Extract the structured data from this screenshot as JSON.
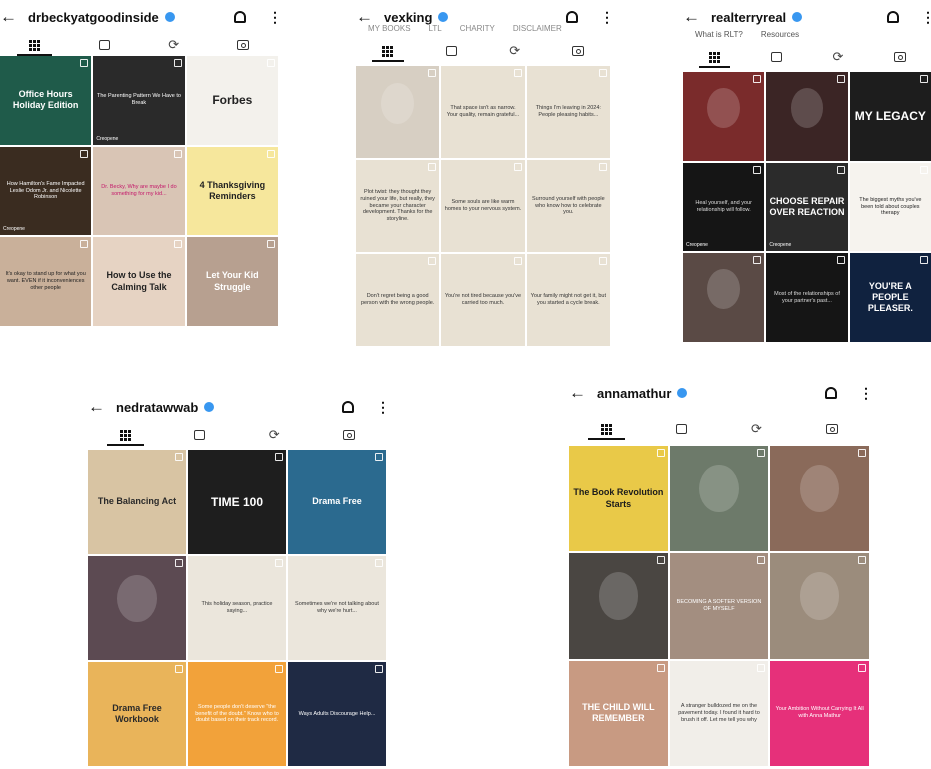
{
  "colors": {
    "verified": "#3897f0",
    "text": "#111111"
  },
  "icons": {
    "back": "back-arrow-icon",
    "notifications": "bell-icon",
    "more": "more-dots-icon",
    "posts": "grid-icon",
    "reels": "reels-icon",
    "tagged": "tagged-icon"
  },
  "glyphs": {
    "back": "←",
    "more": "⋮",
    "reels": "⟳"
  },
  "panels": [
    {
      "username": "drbeckyatgoodinside",
      "cells": [
        {
          "text": "Office Hours Holiday Edition",
          "bg": "#1f5b4a",
          "fg": "#ffffff"
        },
        {
          "text": "The Parenting Pattern We Have to Break",
          "bg": "#2a2a2a",
          "fg": "#ffffff",
          "label": "Creopene"
        },
        {
          "text": "Forbes",
          "bg": "#f3f1ec",
          "fg": "#222222"
        },
        {
          "text": "How Hamilton's Fame Impacted Leslie Odom Jr. and Nicolette Robinson",
          "bg": "#3a2c20",
          "fg": "#ffffff",
          "label": "Creopene"
        },
        {
          "text": "Dr. Becky, Why are maybe I do something for my kid...",
          "bg": "#d9c5b5",
          "fg": "#c4186a"
        },
        {
          "text": "4 Thanksgiving Reminders",
          "bg": "#f6e79c",
          "fg": "#222222"
        },
        {
          "text": "It's okay to stand up for what you want. EVEN if it inconveniences other people",
          "bg": "#c9b09a",
          "fg": "#222222"
        },
        {
          "text": "How to Use the Calming Talk",
          "bg": "#e6d3c3",
          "fg": "#222222"
        },
        {
          "text": "Let Your Kid Struggle",
          "bg": "#b7a090",
          "fg": "#ffffff"
        }
      ]
    },
    {
      "username": "vexking",
      "subnav": [
        "MY BOOKS",
        "LTL",
        "CHARITY",
        "DISCLAIMER"
      ],
      "cells": [
        {
          "text": "",
          "bg": "#d7cfc3",
          "fg": "#222222"
        },
        {
          "text": "That space isn't as narrow. Your quality, remain grateful...",
          "bg": "#e8e1d3",
          "fg": "#333333"
        },
        {
          "text": "Things I'm leaving in 2024: People pleasing habits...",
          "bg": "#e8e1d3",
          "fg": "#333333"
        },
        {
          "text": "Plot twist: they thought they ruined your life, but really, they became your character development. Thanks for the storyline.",
          "bg": "#e8e1d3",
          "fg": "#333333"
        },
        {
          "text": "Some souls are like warm homes to your nervous system.",
          "bg": "#e8e1d3",
          "fg": "#333333"
        },
        {
          "text": "Surround yourself with people who know how to celebrate you.",
          "bg": "#e8e1d3",
          "fg": "#333333"
        },
        {
          "text": "Don't regret being a good person with the wrong people.",
          "bg": "#e8e1d3",
          "fg": "#333333"
        },
        {
          "text": "You're not tired because you've carried too much.",
          "bg": "#e8e1d3",
          "fg": "#333333"
        },
        {
          "text": "Your family might not get it, but you started a cycle break.",
          "bg": "#e8e1d3",
          "fg": "#333333"
        }
      ]
    },
    {
      "username": "realterryreal",
      "subnav": [
        "What is RLT?",
        "Resources"
      ],
      "cells": [
        {
          "text": "",
          "bg": "#7a2b2b",
          "fg": "#ffffff"
        },
        {
          "text": "",
          "bg": "#3b2525",
          "fg": "#ffffff"
        },
        {
          "text": "MY LEGACY",
          "bg": "#1d1d1d",
          "fg": "#ffffff"
        },
        {
          "text": "Heal yourself, and your relationship will follow.",
          "bg": "#151515",
          "fg": "#dddddd",
          "label": "Creopene"
        },
        {
          "text": "CHOOSE REPAIR OVER REACTION",
          "bg": "#2b2b2b",
          "fg": "#ffffff",
          "label": "Creopene"
        },
        {
          "text": "The biggest myths you've been told about couples therapy",
          "bg": "#f6f3ee",
          "fg": "#1c1c1c"
        },
        {
          "text": "",
          "bg": "#5a4a45",
          "fg": "#ffffff"
        },
        {
          "text": "Most of the relationships of your partner's past...",
          "bg": "#151515",
          "fg": "#dddddd"
        },
        {
          "text": "YOU'RE A PEOPLE PLEASER.",
          "bg": "#10223f",
          "fg": "#ffffff"
        }
      ]
    },
    {
      "username": "nedratawwab",
      "cells": [
        {
          "text": "The Balancing Act",
          "bg": "#d8c4a3",
          "fg": "#2a2a2a"
        },
        {
          "text": "TIME 100",
          "bg": "#1e1e1e",
          "fg": "#ffffff"
        },
        {
          "text": "Drama Free",
          "bg": "#2b6a8f",
          "fg": "#ffffff"
        },
        {
          "text": "",
          "bg": "#5c4a52",
          "fg": "#ffffff"
        },
        {
          "text": "This holiday season, practice saying...",
          "bg": "#ebe6dc",
          "fg": "#333333"
        },
        {
          "text": "Sometimes we're not talking about why we're hurt...",
          "bg": "#ebe6dc",
          "fg": "#333333"
        },
        {
          "text": "Drama Free Workbook",
          "bg": "#e9b45a",
          "fg": "#2a2a2a"
        },
        {
          "text": "Some people don't deserve \"the benefit of the doubt.\" Know who to doubt based on their track record.",
          "bg": "#f2a23a",
          "fg": "#ffffff"
        },
        {
          "text": "Ways Adults Discourage Help...",
          "bg": "#1f2a44",
          "fg": "#ffffff"
        }
      ]
    },
    {
      "username": "annamathur",
      "cells": [
        {
          "text": "The Book Revolution Starts",
          "bg": "#e9c948",
          "fg": "#1c1c1c"
        },
        {
          "text": "",
          "bg": "#6d7a6a",
          "fg": "#ffffff"
        },
        {
          "text": "",
          "bg": "#8a6a5a",
          "fg": "#ffffff"
        },
        {
          "text": "",
          "bg": "#4a4642",
          "fg": "#ffffff"
        },
        {
          "text": "BECOMING A SOFTER VERSION OF MYSELF",
          "bg": "#a38e80",
          "fg": "#ffffff"
        },
        {
          "text": "",
          "bg": "#9b8c7c",
          "fg": "#ffffff"
        },
        {
          "text": "THE CHILD WILL REMEMBER",
          "bg": "#c89a82",
          "fg": "#ffffff"
        },
        {
          "text": "A stranger bulldozed me on the pavement today. I found it hard to brush it off. Let me tell you why",
          "bg": "#f1eee9",
          "fg": "#333333"
        },
        {
          "text": "Your Ambition Without Carrying It All with Anna Mathur",
          "bg": "#e6307a",
          "fg": "#ffffff"
        }
      ]
    }
  ]
}
